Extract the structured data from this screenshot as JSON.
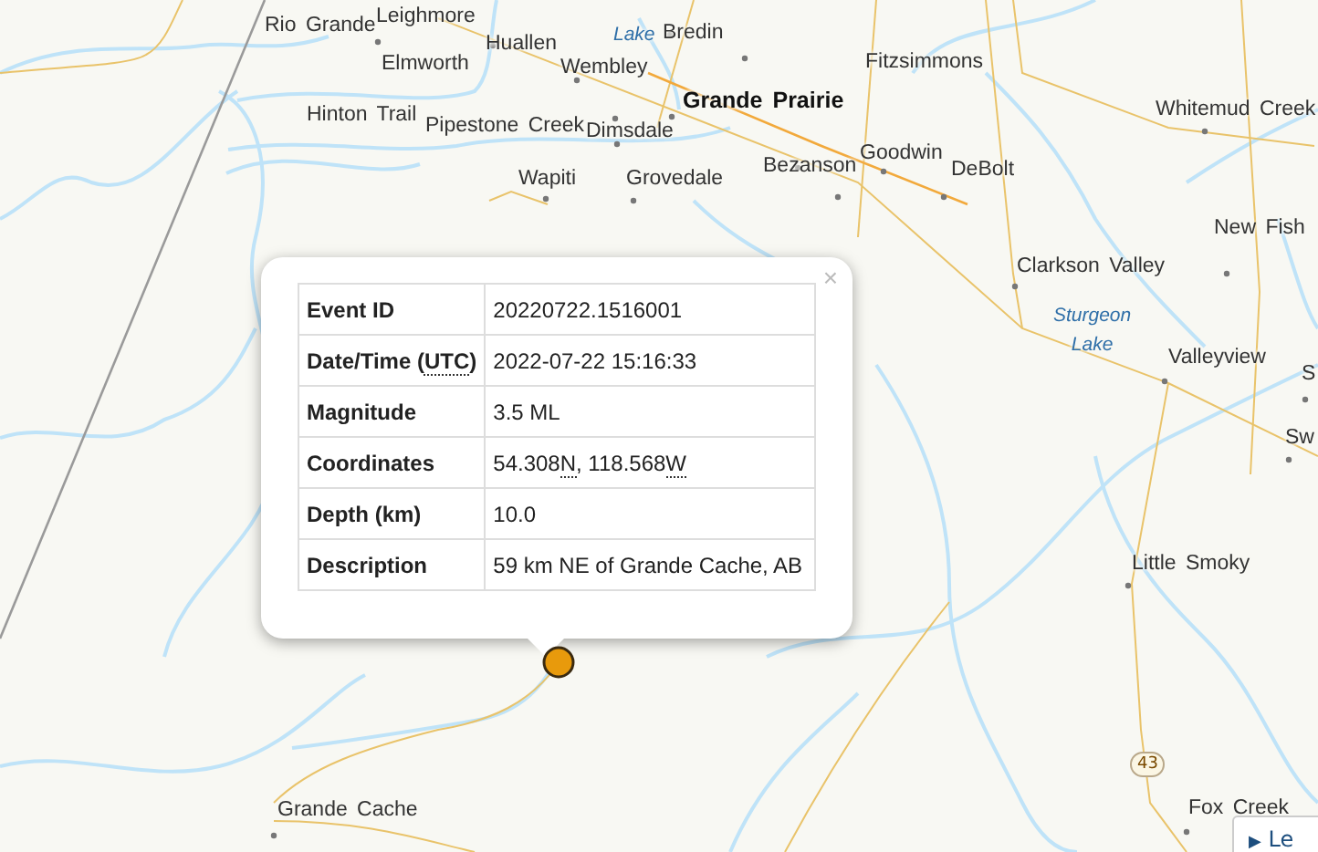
{
  "map": {
    "places": [
      {
        "name": "Rio Grande",
        "kind": "town"
      },
      {
        "name": "Leighmore",
        "kind": "town"
      },
      {
        "name": "Lake",
        "kind": "lake"
      },
      {
        "name": "Bredin",
        "kind": "town"
      },
      {
        "name": "Elmworth",
        "kind": "town"
      },
      {
        "name": "Huallen",
        "kind": "town"
      },
      {
        "name": "Wembley",
        "kind": "town"
      },
      {
        "name": "Fitzsimmons",
        "kind": "town"
      },
      {
        "name": "Hinton Trail",
        "kind": "town"
      },
      {
        "name": "Pipestone Creek",
        "kind": "town"
      },
      {
        "name": "Dimsdale",
        "kind": "town"
      },
      {
        "name": "Grande Prairie",
        "kind": "city"
      },
      {
        "name": "Whitemud Creek",
        "kind": "town"
      },
      {
        "name": "Wapiti",
        "kind": "town"
      },
      {
        "name": "Grovedale",
        "kind": "town"
      },
      {
        "name": "Bezanson",
        "kind": "town"
      },
      {
        "name": "Goodwin",
        "kind": "town"
      },
      {
        "name": "DeBolt",
        "kind": "town"
      },
      {
        "name": "New Fish",
        "kind": "town"
      },
      {
        "name": "Clarkson Valley",
        "kind": "town"
      },
      {
        "name": "Sturgeon Lake",
        "kind": "lake"
      },
      {
        "name": "Valleyview",
        "kind": "town"
      },
      {
        "name": "S",
        "kind": "town"
      },
      {
        "name": "Sw",
        "kind": "town"
      },
      {
        "name": "Little Smoky",
        "kind": "town"
      },
      {
        "name": "Grande Cache",
        "kind": "town"
      },
      {
        "name": "Fox Creek",
        "kind": "town"
      }
    ],
    "highway_shield": "43",
    "legend_button": {
      "icon": "▶",
      "label": "Le"
    }
  },
  "popup": {
    "close": "×",
    "rows": [
      {
        "label": [
          {
            "text": "Event ID"
          }
        ],
        "value": [
          {
            "text": "20220722.1516001"
          }
        ]
      },
      {
        "label": [
          {
            "text": "Date/Time ("
          },
          {
            "text": "UTC",
            "abbr": true
          },
          {
            "text": ")"
          }
        ],
        "value": [
          {
            "text": "2022-07-22 15:16:33"
          }
        ]
      },
      {
        "label": [
          {
            "text": "Magnitude"
          }
        ],
        "value": [
          {
            "text": "3.5 ML"
          }
        ]
      },
      {
        "label": [
          {
            "text": "Coordinates"
          }
        ],
        "value": [
          {
            "text": "54.308"
          },
          {
            "text": "N",
            "abbr": true
          },
          {
            "text": ", 118.568"
          },
          {
            "text": "W",
            "abbr": true
          }
        ]
      },
      {
        "label": [
          {
            "text": "Depth (km)"
          }
        ],
        "value": [
          {
            "text": "10.0"
          }
        ]
      },
      {
        "label": [
          {
            "text": "Description"
          }
        ],
        "value": [
          {
            "text": "59 km NE of Grande Cache, AB"
          }
        ]
      }
    ]
  }
}
